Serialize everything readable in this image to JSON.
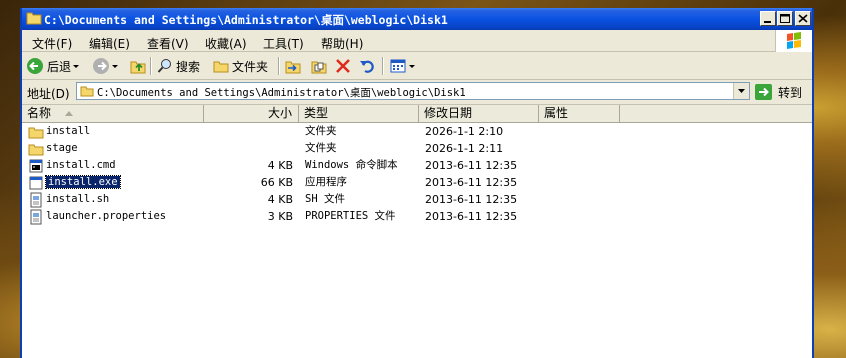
{
  "window": {
    "title": "C:\\Documents and Settings\\Administrator\\桌面\\weblogic\\Disk1"
  },
  "menu": [
    "文件(F)",
    "编辑(E)",
    "查看(V)",
    "收藏(A)",
    "工具(T)",
    "帮助(H)"
  ],
  "toolbar": {
    "back": "后退",
    "search": "搜索",
    "folders": "文件夹"
  },
  "address": {
    "label": "地址(D)",
    "value": "C:\\Documents and Settings\\Administrator\\桌面\\weblogic\\Disk1",
    "go": "转到"
  },
  "columns": {
    "name": "名称",
    "size": "大小",
    "type": "类型",
    "modified": "修改日期",
    "attributes": "属性"
  },
  "files": [
    {
      "name": "install",
      "size": "",
      "type": "文件夹",
      "modified": "2026-1-1 2:10",
      "icon": "folder-icon"
    },
    {
      "name": "stage",
      "size": "",
      "type": "文件夹",
      "modified": "2026-1-1 2:11",
      "icon": "folder-icon"
    },
    {
      "name": "install.cmd",
      "size": "4 KB",
      "type": "Windows 命令脚本",
      "modified": "2013-6-11 12:35",
      "icon": "cmd-file-icon"
    },
    {
      "name": "install.exe",
      "size": "66 KB",
      "type": "应用程序",
      "modified": "2013-6-11 12:35",
      "icon": "exe-file-icon",
      "selected": true
    },
    {
      "name": "install.sh",
      "size": "4 KB",
      "type": "SH 文件",
      "modified": "2013-6-11 12:35",
      "icon": "sh-file-icon"
    },
    {
      "name": "launcher.properties",
      "size": "3 KB",
      "type": "PROPERTIES 文件",
      "modified": "2013-6-11 12:35",
      "icon": "properties-file-icon"
    }
  ],
  "colors": {
    "title_bar": "#0a52e3",
    "selection": "#0a246a",
    "window_face": "#ece9d8"
  }
}
